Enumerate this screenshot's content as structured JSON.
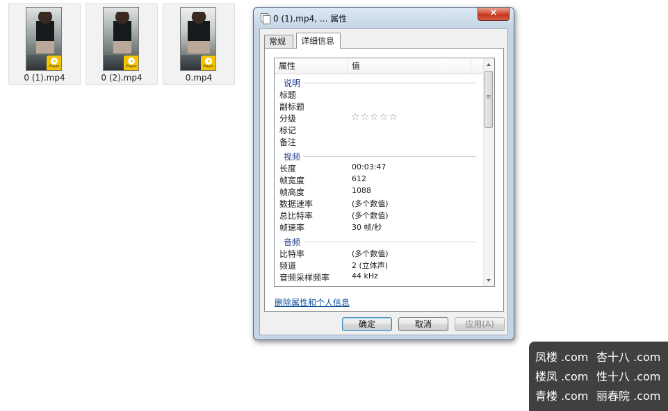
{
  "desktop": {
    "files": [
      {
        "name": "0 (1).mp4",
        "badge": "Player"
      },
      {
        "name": "0 (2).mp4",
        "badge": "Player"
      },
      {
        "name": "0.mp4",
        "badge": "Player"
      }
    ]
  },
  "dialog": {
    "title": "0 (1).mp4, ... 属性",
    "close_label": "✕",
    "tabs": [
      {
        "label": "常规",
        "active": false
      },
      {
        "label": "详细信息",
        "active": true
      }
    ],
    "columns": {
      "name": "属性",
      "value": "值"
    },
    "groups": [
      {
        "label": "说明",
        "rows": [
          {
            "name": "标题",
            "value": ""
          },
          {
            "name": "副标题",
            "value": ""
          },
          {
            "name": "分级",
            "value": "",
            "stars": "☆☆☆☆☆"
          },
          {
            "name": "标记",
            "value": ""
          },
          {
            "name": "备注",
            "value": ""
          }
        ]
      },
      {
        "label": "视频",
        "rows": [
          {
            "name": "长度",
            "value": "00:03:47"
          },
          {
            "name": "帧宽度",
            "value": "612"
          },
          {
            "name": "帧高度",
            "value": "1088"
          },
          {
            "name": "数据速率",
            "value": "(多个数值)"
          },
          {
            "name": "总比特率",
            "value": "(多个数值)"
          },
          {
            "name": "帧速率",
            "value": "30 帧/秒"
          }
        ]
      },
      {
        "label": "音频",
        "rows": [
          {
            "name": "比特率",
            "value": "(多个数值)"
          },
          {
            "name": "频道",
            "value": "2 (立体声)"
          },
          {
            "name": "音频采样频率",
            "value": "44 kHz"
          }
        ]
      }
    ],
    "remove_link": "删除属性和个人信息",
    "buttons": {
      "ok": "确定",
      "cancel": "取消",
      "apply": "应用(A)"
    }
  },
  "watermark": {
    "lines": [
      {
        "left": "凤楼 .com",
        "right": "杏十八 .com"
      },
      {
        "left": "楼凤 .com",
        "right": "性十八 .com"
      },
      {
        "left": "青楼 .com",
        "right": "丽春院 .com"
      }
    ]
  },
  "colors": {
    "dialog_frame": "#c6d5e6",
    "close_button": "#c33a1f",
    "group_label": "#1e3b8a",
    "link": "#0e4e9a",
    "player_badge": "#f5c400"
  }
}
